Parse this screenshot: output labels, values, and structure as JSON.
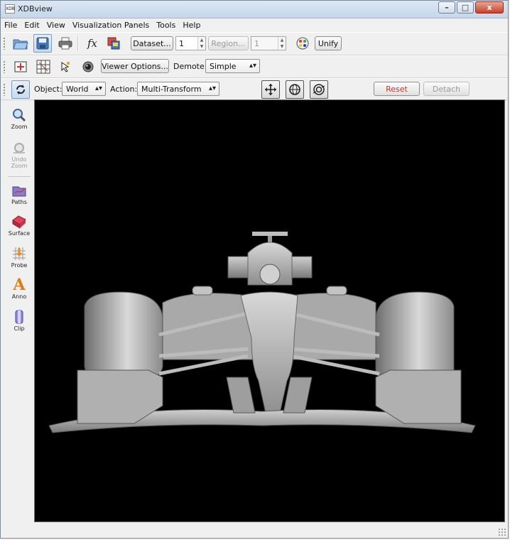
{
  "window": {
    "title": "XDBview",
    "app_icon_text": "XDB",
    "minimize_glyph": "–",
    "maximize_glyph": "□",
    "close_glyph": "x"
  },
  "menu": {
    "items": [
      "File",
      "Edit",
      "View",
      "Visualization Panels",
      "Tools",
      "Help"
    ]
  },
  "toolbar1": {
    "icons": [
      "open-folder-icon",
      "save-icon",
      "print-icon",
      "function-fx-icon",
      "copy-windows-icon",
      "color-palette-icon"
    ],
    "fx_glyph": "fx",
    "dataset_label": "Dataset...",
    "dataset_value": "1",
    "region_label": "Region...",
    "region_value": "1",
    "unify_label": "Unify"
  },
  "toolbar2": {
    "icons": [
      "fit-view-icon",
      "grid-view-icon",
      "pointer-probe-icon",
      "camera-lens-icon"
    ],
    "viewer_options_label": "Viewer Options...",
    "demote_label": "Demote:",
    "demote_value": "Simple"
  },
  "toolbar3": {
    "icons": [
      "transform-cycle-icon",
      "move-arrows-icon",
      "rotate-sphere-icon",
      "zoom-rotate-icon"
    ],
    "object_label": "Object:",
    "object_value": "World",
    "action_label": "Action:",
    "action_value": "Multi-Transform",
    "reset_label": "Reset",
    "detach_label": "Detach",
    "reset_color": "#c0392b"
  },
  "sidebar": {
    "items": [
      {
        "label": "Zoom",
        "icon": "magnifier-icon",
        "enabled": true
      },
      {
        "label": "Undo Zoom",
        "icon": "undo-zoom-icon",
        "enabled": false
      },
      {
        "label": "Paths",
        "icon": "paths-icon",
        "enabled": true
      },
      {
        "label": "Surface",
        "icon": "surface-icon",
        "enabled": true
      },
      {
        "label": "Probe",
        "icon": "probe-icon",
        "enabled": true
      },
      {
        "label": "Anno",
        "icon": "annotation-a-icon",
        "enabled": true
      },
      {
        "label": "Clip",
        "icon": "clip-icon",
        "enabled": true
      }
    ]
  },
  "viewport": {
    "background": "#000000",
    "model_color": "#b8b8b8"
  }
}
